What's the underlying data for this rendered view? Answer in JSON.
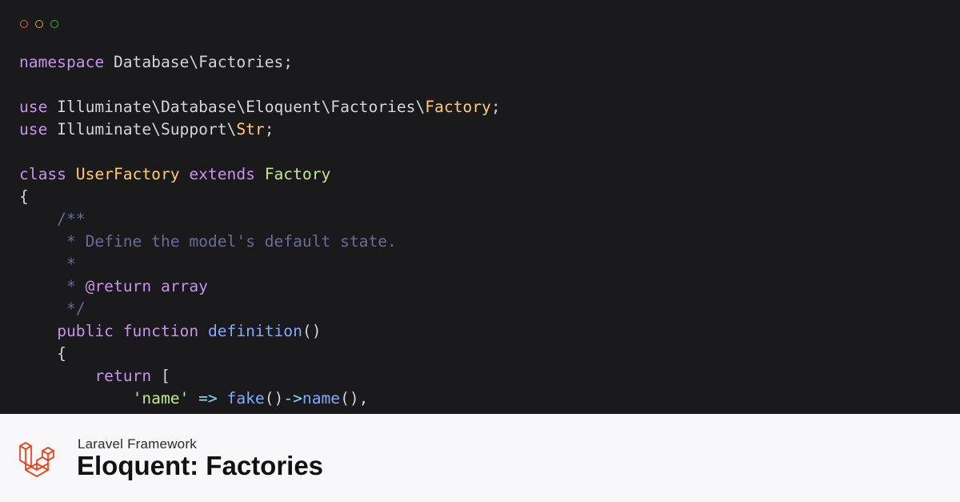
{
  "window": {
    "controls": [
      "close",
      "minimize",
      "maximize"
    ]
  },
  "code": {
    "lines": [
      [
        {
          "t": "namespace",
          "c": "kw"
        },
        {
          "t": " Database\\Factories;",
          "c": "plain"
        }
      ],
      [],
      [
        {
          "t": "use",
          "c": "kw"
        },
        {
          "t": " Illuminate\\Database\\Eloquent\\Factories\\",
          "c": "plain"
        },
        {
          "t": "Factory",
          "c": "cls"
        },
        {
          "t": ";",
          "c": "plain"
        }
      ],
      [
        {
          "t": "use",
          "c": "kw"
        },
        {
          "t": " Illuminate\\Support\\",
          "c": "plain"
        },
        {
          "t": "Str",
          "c": "cls"
        },
        {
          "t": ";",
          "c": "plain"
        }
      ],
      [],
      [
        {
          "t": "class",
          "c": "kw"
        },
        {
          "t": " ",
          "c": "plain"
        },
        {
          "t": "UserFactory",
          "c": "cls"
        },
        {
          "t": " ",
          "c": "plain"
        },
        {
          "t": "extends",
          "c": "kw"
        },
        {
          "t": " ",
          "c": "plain"
        },
        {
          "t": "Factory",
          "c": "parent"
        }
      ],
      [
        {
          "t": "{",
          "c": "plain"
        }
      ],
      [
        {
          "t": "    /**",
          "c": "cmt"
        }
      ],
      [
        {
          "t": "     * Define the model's default state.",
          "c": "cmt"
        }
      ],
      [
        {
          "t": "     *",
          "c": "cmt"
        }
      ],
      [
        {
          "t": "     * ",
          "c": "cmt"
        },
        {
          "t": "@return",
          "c": "doc"
        },
        {
          "t": " array",
          "c": "doc"
        }
      ],
      [
        {
          "t": "     */",
          "c": "cmt"
        }
      ],
      [
        {
          "t": "    ",
          "c": "plain"
        },
        {
          "t": "public",
          "c": "kw"
        },
        {
          "t": " ",
          "c": "plain"
        },
        {
          "t": "function",
          "c": "kw"
        },
        {
          "t": " ",
          "c": "plain"
        },
        {
          "t": "definition",
          "c": "fn"
        },
        {
          "t": "()",
          "c": "plain"
        }
      ],
      [
        {
          "t": "    {",
          "c": "plain"
        }
      ],
      [
        {
          "t": "        ",
          "c": "plain"
        },
        {
          "t": "return",
          "c": "kw"
        },
        {
          "t": " [",
          "c": "plain"
        }
      ],
      [
        {
          "t": "            ",
          "c": "plain"
        },
        {
          "t": "'name'",
          "c": "str"
        },
        {
          "t": " ",
          "c": "plain"
        },
        {
          "t": "=>",
          "c": "op"
        },
        {
          "t": " ",
          "c": "plain"
        },
        {
          "t": "fake",
          "c": "fn"
        },
        {
          "t": "()",
          "c": "plain"
        },
        {
          "t": "->",
          "c": "op"
        },
        {
          "t": "name",
          "c": "fn"
        },
        {
          "t": "(),",
          "c": "plain"
        }
      ]
    ]
  },
  "footer": {
    "logo_icon": "laravel-logo-icon",
    "subtitle": "Laravel Framework",
    "title": "Eloquent: Factories"
  },
  "colors": {
    "editor_bg": "#1a1a1c",
    "footer_bg": "#f8f8fa",
    "brand": "#f53003"
  }
}
